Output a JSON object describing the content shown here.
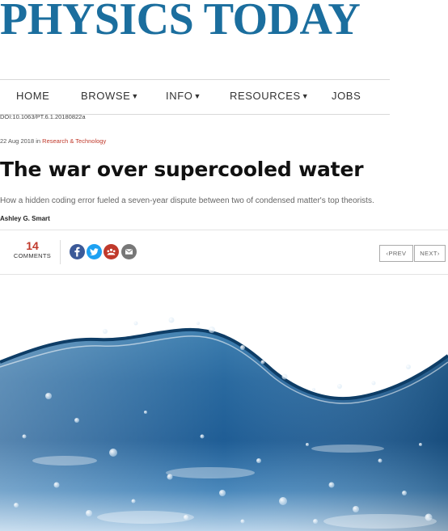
{
  "site": {
    "masthead": "PHYSICS TODAY"
  },
  "nav": {
    "items": [
      {
        "label": "HOME",
        "dropdown": false
      },
      {
        "label": "BROWSE",
        "dropdown": true
      },
      {
        "label": "INFO",
        "dropdown": true
      },
      {
        "label": "RESOURCES",
        "dropdown": true
      },
      {
        "label": "JOBS",
        "dropdown": false
      }
    ]
  },
  "article": {
    "doi": "DOI:10.1063/PT.6.1.20180822a",
    "date": "22 Aug 2018",
    "date_sep": " in ",
    "category": "Research & Technology",
    "title": "The war over supercooled water",
    "subtitle": "How a hidden coding error fueled a seven-year dispute between two of condensed matter's top theorists.",
    "author": "Ashley G. Smart"
  },
  "share": {
    "comment_count": "14",
    "comments_label": "COMMENTS",
    "icons": [
      {
        "name": "facebook-icon",
        "color": "#3b5998"
      },
      {
        "name": "twitter-icon",
        "color": "#1da1f2"
      },
      {
        "name": "reddit-icon",
        "color": "#c0392b"
      },
      {
        "name": "email-icon",
        "color": "#777777"
      }
    ]
  },
  "pager": {
    "prev": "PREV",
    "next": "NEXT"
  },
  "hero": {
    "icon": "water-wave-image"
  },
  "colors": {
    "brand": "#1b6e9e",
    "accent": "#c0392b"
  }
}
